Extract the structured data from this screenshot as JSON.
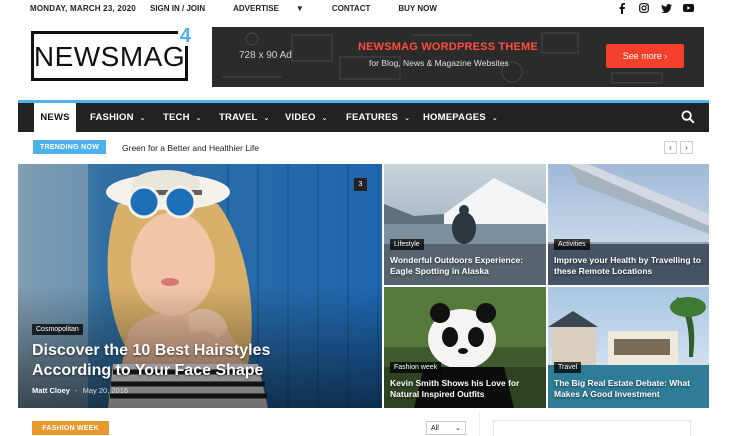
{
  "topbar": {
    "date": "MONDAY, MARCH 23, 2020",
    "links": [
      "SIGN IN / JOIN",
      "ADVERTISE",
      "CONTACT",
      "BUY NOW"
    ],
    "social_icons": [
      "facebook-icon",
      "instagram-icon",
      "twitter-icon",
      "youtube-icon"
    ]
  },
  "logo": {
    "word": "NEWSMAG",
    "number": "4"
  },
  "ad": {
    "size": "728 x 90 Ad",
    "title": "NEWSMAG WORDPRESS THEME",
    "subtitle": "for Blog, News & Magazine Websites",
    "button": "See more ›"
  },
  "nav": {
    "items": [
      "NEWS",
      "FASHION",
      "TECH",
      "TRAVEL",
      "VIDEO",
      "FEATURES",
      "HOMEPAGES"
    ],
    "active": "NEWS"
  },
  "trending": {
    "label": "TRENDING NOW",
    "text": "Green for a Better and Healthier Life",
    "prev": "‹",
    "next": "›"
  },
  "featured": {
    "category": "Cosmopolitan",
    "title": "Discover the 10 Best Hairstyles According to Your Face Shape",
    "author": "Matt Cloey",
    "separator": "-",
    "date": "May 20, 2016",
    "comments": "3"
  },
  "tiles": [
    {
      "category": "Lifestyle",
      "title": "Wonderful Outdoors Experience: Eagle Spotting in Alaska"
    },
    {
      "category": "Activities",
      "title": "Improve your Health by Travelling to these Remote Locations"
    },
    {
      "category": "Fashion week",
      "title": "Kevin Smith Shows his Love for Natural Inspired Outfits"
    },
    {
      "category": "Travel",
      "title": "The Big Real Estate Debate: What Makes A Good Investment"
    }
  ],
  "bottom": {
    "block_title": "FASHION WEEK",
    "filter": "All"
  },
  "colors": {
    "accent": "#4db2ec",
    "nav_bg": "#222222",
    "ad_button": "#f43f2b",
    "fashion_tag": "#e69a2e"
  }
}
